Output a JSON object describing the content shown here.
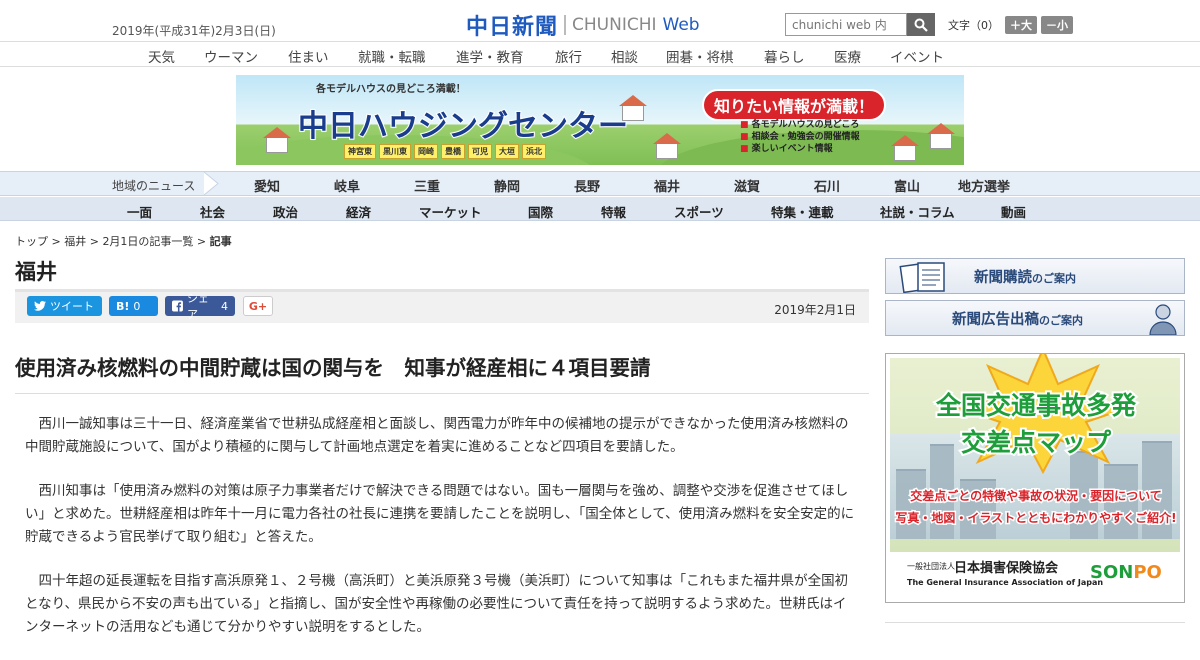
{
  "header": {
    "date": "2019年(平成31年)2月3日(日)",
    "logo_jp": "中日新聞",
    "logo_en_1": "CHUNICHI",
    "logo_en_2": "Web",
    "search_placeholder": "chunichi web 内",
    "font_label": "文字（0）",
    "font_larger": "＋大",
    "font_smaller": "－小"
  },
  "category_nav": [
    "天気",
    "ウーマン",
    "住まい",
    "就職・転職",
    "進学・教育",
    "旅行",
    "相談",
    "囲碁・将棋",
    "暮らし",
    "医療",
    "イベント"
  ],
  "banner": {
    "top_text": "各モデルハウスの見どころ満載！",
    "title": "中日ハウジングセンター",
    "badge": "知りたい情報が満載！",
    "features": [
      "各モデルハウスの見どころ",
      "相談会・勉強会の開催情報",
      "楽しいイベント情報"
    ],
    "towns": [
      "神宮東",
      "黒川東",
      "岡崎",
      "豊橋",
      "可児",
      "大垣",
      "浜北"
    ]
  },
  "region_nav": {
    "label": "地域のニュース",
    "items": [
      "愛知",
      "岐阜",
      "三重",
      "静岡",
      "長野",
      "福井",
      "滋賀",
      "石川",
      "富山",
      "地方選挙"
    ]
  },
  "section_nav": [
    "一面",
    "社会",
    "政治",
    "経済",
    "マーケット",
    "国際",
    "特報",
    "スポーツ",
    "特集・連載",
    "社説・コラム",
    "動画"
  ],
  "breadcrumb": {
    "top": "トップ",
    "sep": " > ",
    "region": "福井",
    "list": "2月1日の記事一覧",
    "current": "記事"
  },
  "section_title": "福井",
  "share": {
    "tweet": "ツイート",
    "hatena": "B!",
    "hatena_count": "0",
    "fb_label": "シェア",
    "fb_count": "4",
    "gplus": "G+"
  },
  "article": {
    "date": "2019年2月1日",
    "headline": "使用済み核燃料の中間貯蔵は国の関与を　知事が経産相に４項目要請",
    "paragraphs": [
      "西川一誠知事は三十一日、経済産業省で世耕弘成経産相と面談し、関西電力が昨年中の候補地の提示ができなかった使用済み核燃料の中間貯蔵施設について、国がより積極的に関与して計画地点選定を着実に進めることなど四項目を要請した。",
      "西川知事は「使用済み燃料の対策は原子力事業者だけで解決できる問題ではない。国も一層関与を強め、調整や交渉を促進させてほしい」と求めた。世耕経産相は昨年十一月に電力各社の社長に連携を要請したことを説明し、「国全体として、使用済み燃料を安全安定的に貯蔵できるよう官民挙げて取り組む」と答えた。",
      "四十年超の延長運転を目指す高浜原発１、２号機（高浜町）と美浜原発３号機（美浜町）について知事は「これもまた福井県が全国初となり、県民から不安の声も出ている」と指摘し、国が安全性や再稼働の必要性について責任を持って説明するよう求めた。世耕氏はインターネットの活用なども通じて分かりやすい説明をするとした。"
    ]
  },
  "sidebar": {
    "subscribe_main": "新聞購読",
    "subscribe_sub": "のご案内",
    "ads_main": "新聞広告出稿",
    "ads_sub": "のご案内"
  },
  "ad": {
    "title_1": "全国交通事故多発",
    "title_2": "交差点マップ",
    "desc_1": "交差点ごとの特徴や事故の状況・要因について",
    "desc_2": "写真・地図・イラストとともにわかりやすくご紹介!",
    "org_prefix": "一般社団法人",
    "org_name": "日本損害保険協会",
    "org_en": "The General Insurance Association of Japan",
    "brand_1": "SON",
    "brand_2": "PO"
  },
  "colors": {
    "logo_blue": "#1f5bbf",
    "twitter": "#1b95e0",
    "hatena": "#1a8ae0",
    "facebook": "#3b5998",
    "ad_green": "#1e9e3a",
    "ad_red": "#d9242b"
  }
}
